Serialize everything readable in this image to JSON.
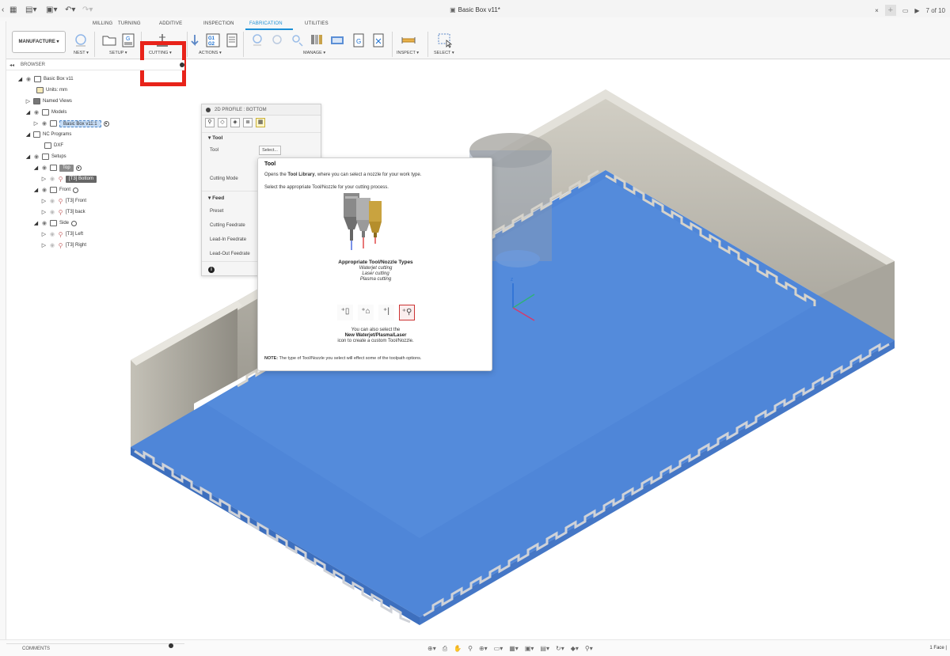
{
  "window": {
    "title": "Basic Box v11*",
    "page_counter": "7 of 10"
  },
  "ribbon": {
    "workspace": "MANUFACTURE ▾",
    "tabs": [
      "MILLING",
      "TURNING",
      "ADDITIVE",
      "INSPECTION",
      "FABRICATION",
      "UTILITIES"
    ],
    "active_tab": "FABRICATION",
    "groups": {
      "nest": "NEST ▾",
      "setup": "SETUP ▾",
      "cutting": "CUTTING ▾",
      "actions": "ACTIONS ▾",
      "manage": "MANAGE ▾",
      "inspect": "INSPECT ▾",
      "select": "SELECT ▾"
    },
    "highlight_color": "#e8231a"
  },
  "browser": {
    "header": "BROWSER",
    "items": {
      "root": "Basic Box v11",
      "units": "Units: mm",
      "named_views": "Named Views",
      "models": "Models",
      "model_item": "Basic Box v11:1",
      "nc_programs": "NC Programs",
      "dxf": "DXF",
      "setups": "Setups",
      "top": "Top",
      "bottom": "[T3] Bottom",
      "front": "Front",
      "front_op": "[T3] Front",
      "back_op": "[T3] back",
      "side": "Side",
      "left_op": "[T3] Left",
      "right_op": "[T3] Right"
    }
  },
  "dialog": {
    "title": "2D PROFILE : BOTTOM",
    "tool_section": "Tool",
    "tool_label": "Tool",
    "select_button": "Select...",
    "cutting_mode_label": "Cutting Mode",
    "feed_section": "Feed",
    "preset_label": "Preset",
    "cutting_feedrate_label": "Cutting Feedrate",
    "leadin_feedrate_label": "Lead-In Feedrate",
    "leadout_feedrate_label": "Lead-Out Feedrate"
  },
  "tooltip": {
    "title": "Tool",
    "desc_pre": "Opens the ",
    "desc_bold": "Tool Library",
    "desc_post": ", where you can select a nozzle for your work type.",
    "desc2": "Select the appropriate Tool/Nozzle for your cutting process.",
    "types_title": "Appropriate Tool/Nozzle Types",
    "types": [
      "Waterjet cutting",
      "Laser cutting",
      "Plasma cutting"
    ],
    "also1": "You can also select the",
    "also2": "New Waterjet/Plasma/Laser",
    "also3": "icon to create a custom Tool/Nozzle.",
    "note_bold": "NOTE:",
    "note_rest": " The type of Tool/Nozzle you select will effect some of the toolpath options."
  },
  "bottom": {
    "comments": "COMMENTS",
    "face_count": "1 Face |"
  },
  "colors": {
    "accent": "#1a8fd6",
    "face_blue": "#4f86d8",
    "wall": "#b9b6ab"
  }
}
